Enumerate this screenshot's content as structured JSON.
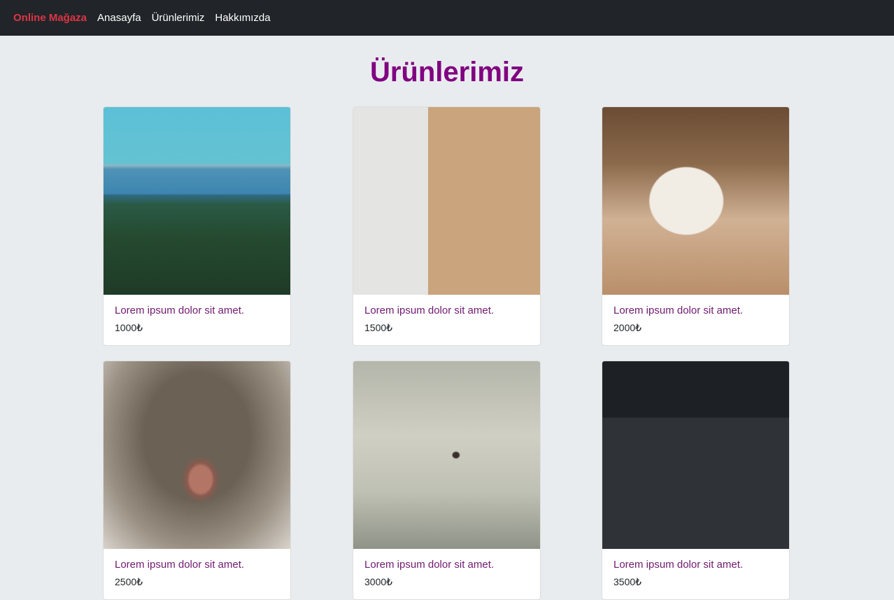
{
  "navbar": {
    "brand": "Online Mağaza",
    "links": [
      "Anasayfa",
      "Ürünlerimiz",
      "Hakkımızda"
    ]
  },
  "page": {
    "title": "Ürünlerimiz"
  },
  "colors": {
    "navbar_bg": "#212529",
    "brand": "#dc3545",
    "title": "#800080",
    "card_title": "#6f1a6f",
    "page_bg": "#e9ecef"
  },
  "products": [
    {
      "title": "Lorem ipsum dolor sit amet.",
      "price": "1000₺",
      "image": "forest-lake-photo"
    },
    {
      "title": "Lorem ipsum dolor sit amet.",
      "price": "1500₺",
      "image": "desk-books-photo"
    },
    {
      "title": "Lorem ipsum dolor sit amet.",
      "price": "2000₺",
      "image": "mug-photo"
    },
    {
      "title": "Lorem ipsum dolor sit amet.",
      "price": "2500₺",
      "image": "cat-nose-photo"
    },
    {
      "title": "Lorem ipsum dolor sit amet.",
      "price": "3000₺",
      "image": "sea-bird-photo"
    },
    {
      "title": "Lorem ipsum dolor sit amet.",
      "price": "3500₺",
      "image": "desk-workspace-photo"
    }
  ]
}
